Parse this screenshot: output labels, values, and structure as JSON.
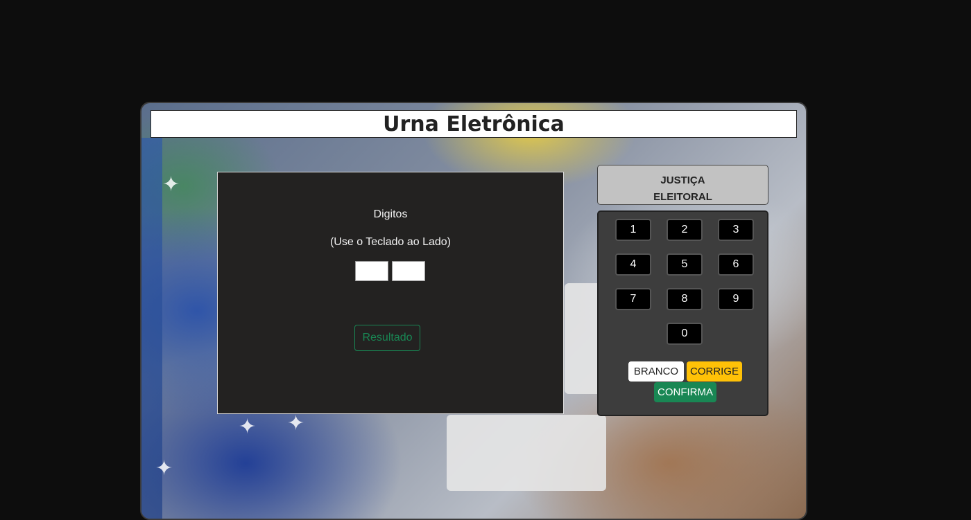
{
  "app": {
    "title": "Urna Eletrônica"
  },
  "screen": {
    "label": "Digitos",
    "instruction": "(Use o Teclado ao Lado)",
    "digits": [
      "",
      ""
    ],
    "result_button": "Resultado"
  },
  "panel": {
    "header_line1": "JUSTIÇA",
    "header_line2": "ELEITORAL"
  },
  "keypad": {
    "keys": [
      "1",
      "2",
      "3",
      "4",
      "5",
      "6",
      "7",
      "8",
      "9",
      "0"
    ],
    "branco": "BRANCO",
    "corrige": "CORRIGE",
    "confirma": "CONFIRMA"
  },
  "colors": {
    "page_bg": "#0d0d0d",
    "screen_bg": "#232221",
    "success": "#198754",
    "warning": "#ffc107",
    "panel_header": "#c2c2c2",
    "keypad_bg": "#3d3d3d"
  }
}
